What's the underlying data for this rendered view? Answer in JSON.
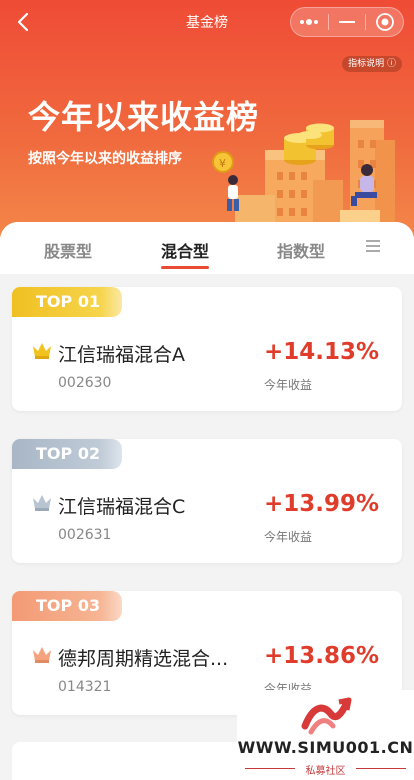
{
  "nav": {
    "back_icon": "chevron-left-icon",
    "title": "基金榜",
    "capsule": {
      "more_icon": "more-dots-icon",
      "minimize_icon": "minus-icon",
      "close_icon": "target-circle-icon"
    }
  },
  "banner": {
    "indicator_label": "指标说明",
    "indicator_icon": "info-icon",
    "title": "今年以来收益榜",
    "subtitle": "按照今年以来的收益排序"
  },
  "tabs": {
    "items": [
      {
        "label": "股票型",
        "active": false
      },
      {
        "label": "混合型",
        "active": true
      },
      {
        "label": "指数型",
        "active": false
      }
    ],
    "menu_icon": "list-menu-icon"
  },
  "funds": [
    {
      "rank_label": "TOP 01",
      "tier": "gold",
      "name": "江信瑞福混合A",
      "code": "002630",
      "return": "+14.13%",
      "return_label": "今年收益"
    },
    {
      "rank_label": "TOP 02",
      "tier": "silver",
      "name": "江信瑞福混合C",
      "code": "002631",
      "return": "+13.99%",
      "return_label": "今年收益"
    },
    {
      "rank_label": "TOP 03",
      "tier": "bronze",
      "name": "德邦周期精选混合...",
      "code": "014321",
      "return": "+13.86%",
      "return_label": "今年收益"
    }
  ],
  "watermark": {
    "site": "WWW.SIMU001.CN",
    "label": "私募社区"
  },
  "colors": {
    "brand_red": "#e84a32",
    "gain_red": "#e03c2c",
    "gold": "#f0c022",
    "silver": "#a8b6c6",
    "bronze": "#f39a74"
  }
}
